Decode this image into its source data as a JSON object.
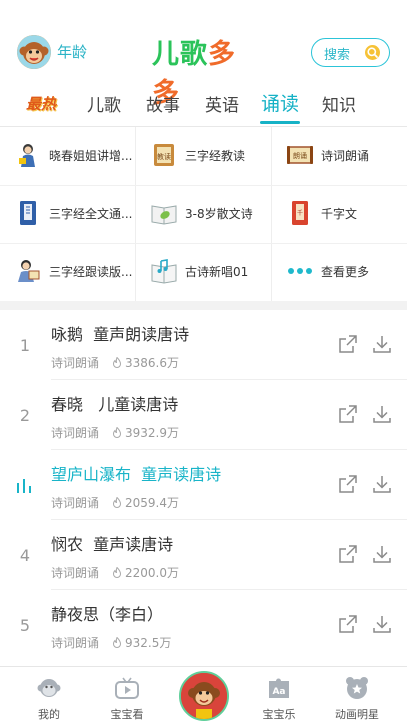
{
  "header": {
    "age_label": "年龄",
    "logo_text": [
      "儿",
      "歌",
      "多",
      "多"
    ],
    "logo_colors": [
      "#2bc35a",
      "#2bc35a",
      "#f06b2a",
      "#f06b2a"
    ],
    "search_label": "搜索"
  },
  "tabs": [
    {
      "label": "最热",
      "active": false,
      "hot": true
    },
    {
      "label": "儿歌",
      "active": false
    },
    {
      "label": "故事",
      "active": false
    },
    {
      "label": "英语",
      "active": false
    },
    {
      "label": "诵读",
      "active": true
    },
    {
      "label": "知识",
      "active": false
    }
  ],
  "categories": [
    {
      "label": "晓春姐姐讲增...",
      "icon": "storyteller-icon"
    },
    {
      "label": "三字经教读",
      "icon": "scroll-book-icon"
    },
    {
      "label": "诗词朗诵",
      "icon": "poem-scroll-icon"
    },
    {
      "label": "三字经全文通...",
      "icon": "blue-book-icon"
    },
    {
      "label": "3-8岁散文诗",
      "icon": "leaf-book-icon"
    },
    {
      "label": "千字文",
      "icon": "red-book-icon"
    },
    {
      "label": "三字经跟读版...",
      "icon": "reading-child-icon"
    },
    {
      "label": "古诗新唱01",
      "icon": "music-book-icon"
    },
    {
      "label": "查看更多",
      "icon": "more-dots-icon"
    }
  ],
  "songs": [
    {
      "num": "1",
      "title": "咏鹅  童声朗读唐诗",
      "category": "诗词朗诵",
      "plays": "3386.6万",
      "playing": false
    },
    {
      "num": "2",
      "title": "春晓   儿童读唐诗",
      "category": "诗词朗诵",
      "plays": "3932.9万",
      "playing": false
    },
    {
      "num": "3",
      "title": "望庐山瀑布  童声读唐诗",
      "category": "诗词朗诵",
      "plays": "2059.4万",
      "playing": true
    },
    {
      "num": "4",
      "title": "悯农  童声读唐诗",
      "category": "诗词朗诵",
      "plays": "2200.0万",
      "playing": false
    },
    {
      "num": "5",
      "title": "静夜思（李白）",
      "category": "诗词朗诵",
      "plays": "932.5万",
      "playing": false
    }
  ],
  "bottom_nav": [
    {
      "label": "我的",
      "icon": "monkey-face-icon"
    },
    {
      "label": "宝宝看",
      "icon": "tv-icon"
    },
    {
      "label": "宝宝乐",
      "icon": "aa-puzzle-icon"
    },
    {
      "label": "动画明星",
      "icon": "bear-face-icon"
    }
  ],
  "colors": {
    "accent": "#16b2c6",
    "hot": "#e05a1a"
  }
}
